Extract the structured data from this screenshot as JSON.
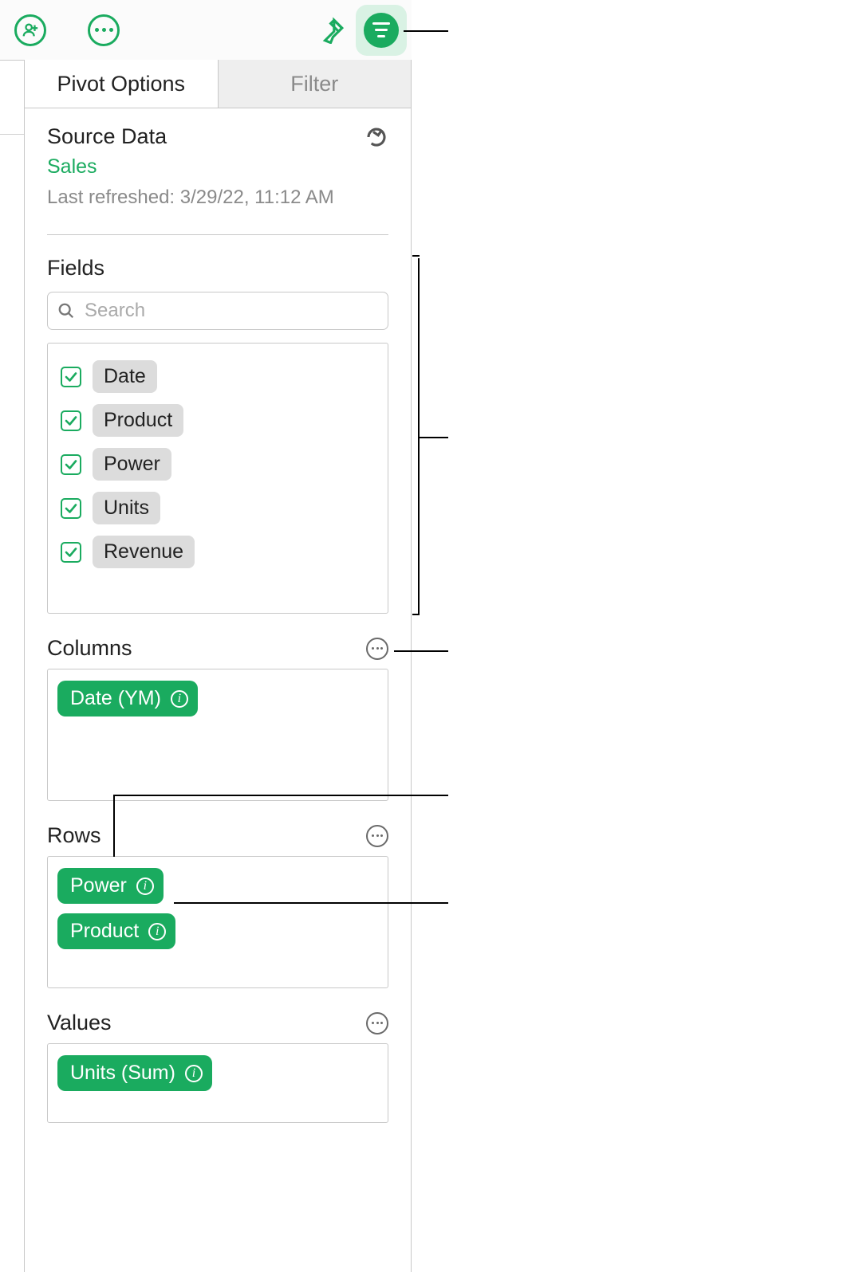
{
  "toolbar": {
    "collaborate_icon": "collaborate-icon",
    "more_icon": "more-icon",
    "format_icon": "format-paintbrush-icon",
    "organize_icon": "organize-icon"
  },
  "tabs": {
    "pivot_options": "Pivot Options",
    "filter": "Filter"
  },
  "source": {
    "heading": "Source Data",
    "name": "Sales",
    "refreshed_label": "Last refreshed: 3/29/22, 11:12 AM"
  },
  "fields": {
    "heading": "Fields",
    "search_placeholder": "Search",
    "items": [
      {
        "label": "Date",
        "checked": true
      },
      {
        "label": "Product",
        "checked": true
      },
      {
        "label": "Power",
        "checked": true
      },
      {
        "label": "Units",
        "checked": true
      },
      {
        "label": "Revenue",
        "checked": true
      }
    ]
  },
  "columns": {
    "heading": "Columns",
    "items": [
      {
        "label": "Date (YM)"
      }
    ]
  },
  "rows": {
    "heading": "Rows",
    "items": [
      {
        "label": "Power"
      },
      {
        "label": "Product"
      }
    ]
  },
  "values": {
    "heading": "Values",
    "items": [
      {
        "label": "Units (Sum)"
      }
    ]
  }
}
